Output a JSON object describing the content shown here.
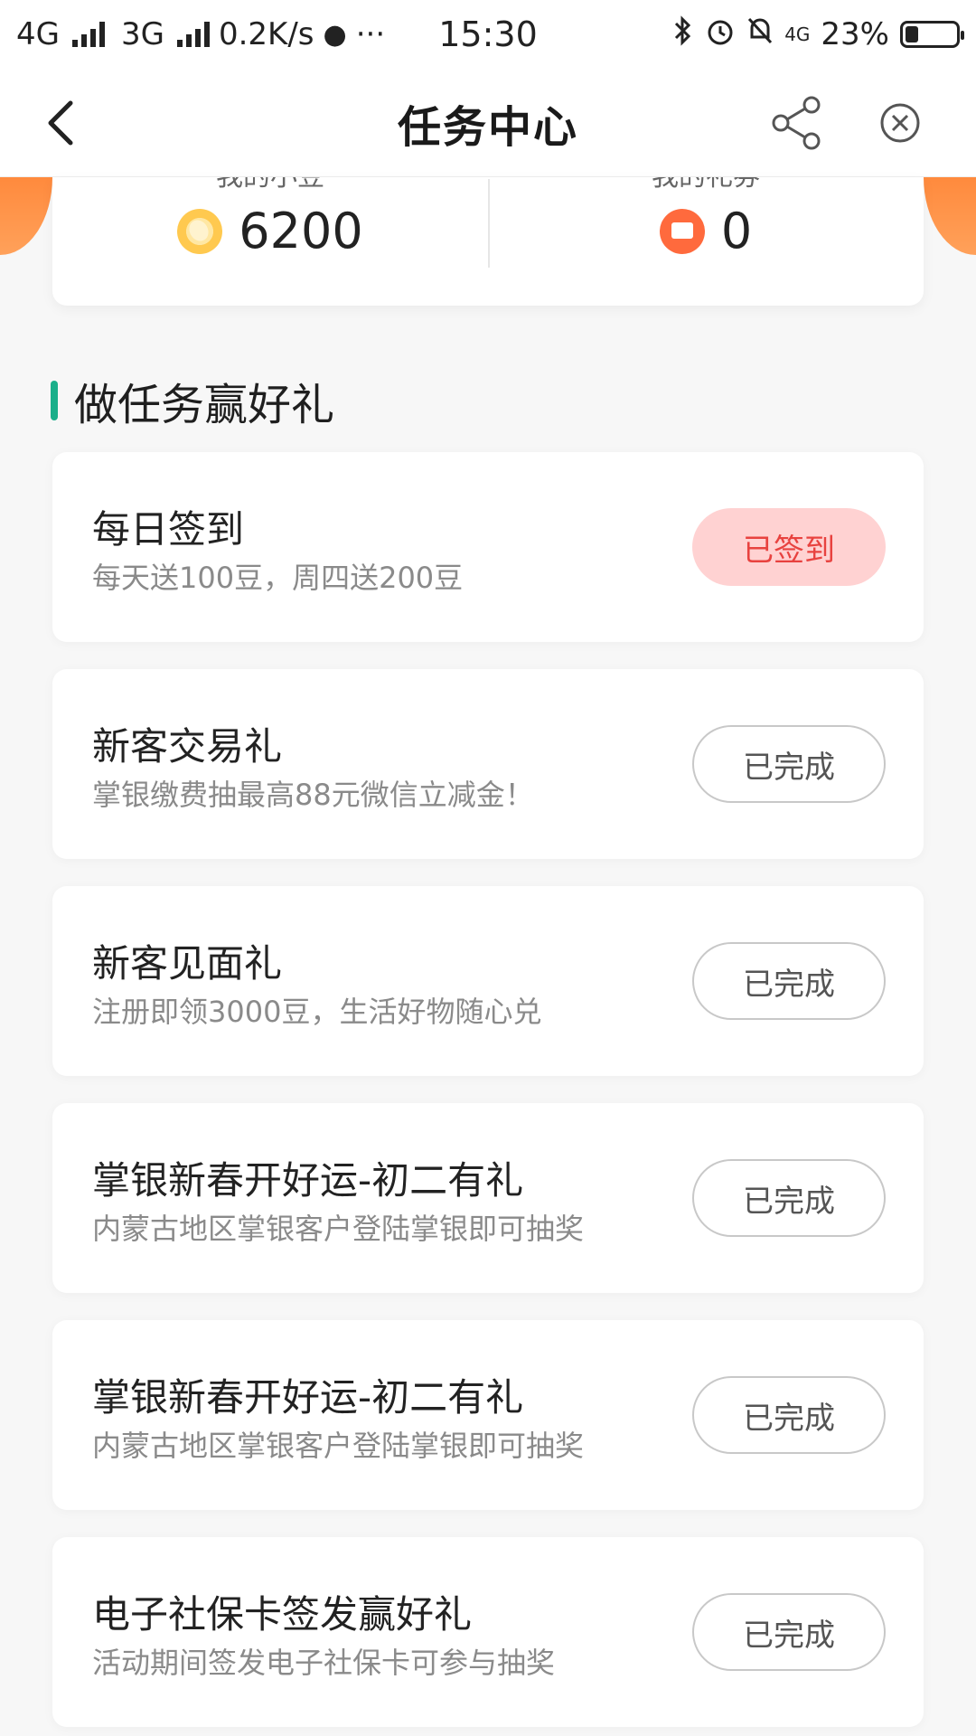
{
  "status_bar": {
    "net1": "4G",
    "net2": "3G",
    "speed": "0.2K/s",
    "more": "···",
    "time": "15:30",
    "right_net": "4G",
    "battery": "23%",
    "battery_level": 0.23
  },
  "nav": {
    "title": "任务中心",
    "back_icon": "chevron-left-icon",
    "share_icon": "share-icon",
    "close_icon": "close-circle-icon"
  },
  "summary": {
    "beans_label": "我的小豆",
    "beans_value": "6200",
    "tickets_label": "我的礼券",
    "tickets_value": "0"
  },
  "section": {
    "title": "做任务赢好礼"
  },
  "tasks": [
    {
      "name": "每日签到",
      "desc": "每天送100豆，周四送200豆",
      "button": "已签到",
      "state": "signed"
    },
    {
      "name": "新客交易礼",
      "desc": "掌银缴费抽最高88元微信立减金！",
      "button": "已完成",
      "state": "done"
    },
    {
      "name": "新客见面礼",
      "desc": "注册即领3000豆，生活好物随心兑",
      "button": "已完成",
      "state": "done"
    },
    {
      "name": "掌银新春开好运-初二有礼",
      "desc": "内蒙古地区掌银客户登陆掌银即可抽奖",
      "button": "已完成",
      "state": "done"
    },
    {
      "name": "掌银新春开好运-初二有礼",
      "desc": "内蒙古地区掌银客户登陆掌银即可抽奖",
      "button": "已完成",
      "state": "done"
    },
    {
      "name": "电子社保卡签发赢好礼",
      "desc": "活动期间签发电子社保卡可参与抽奖",
      "button": "已完成",
      "state": "done"
    }
  ],
  "colors": {
    "accent_green": "#1aaf8a",
    "signed_bg": "#ffd2d2",
    "signed_text": "#e8423f",
    "orange": "#ff8a3d"
  }
}
